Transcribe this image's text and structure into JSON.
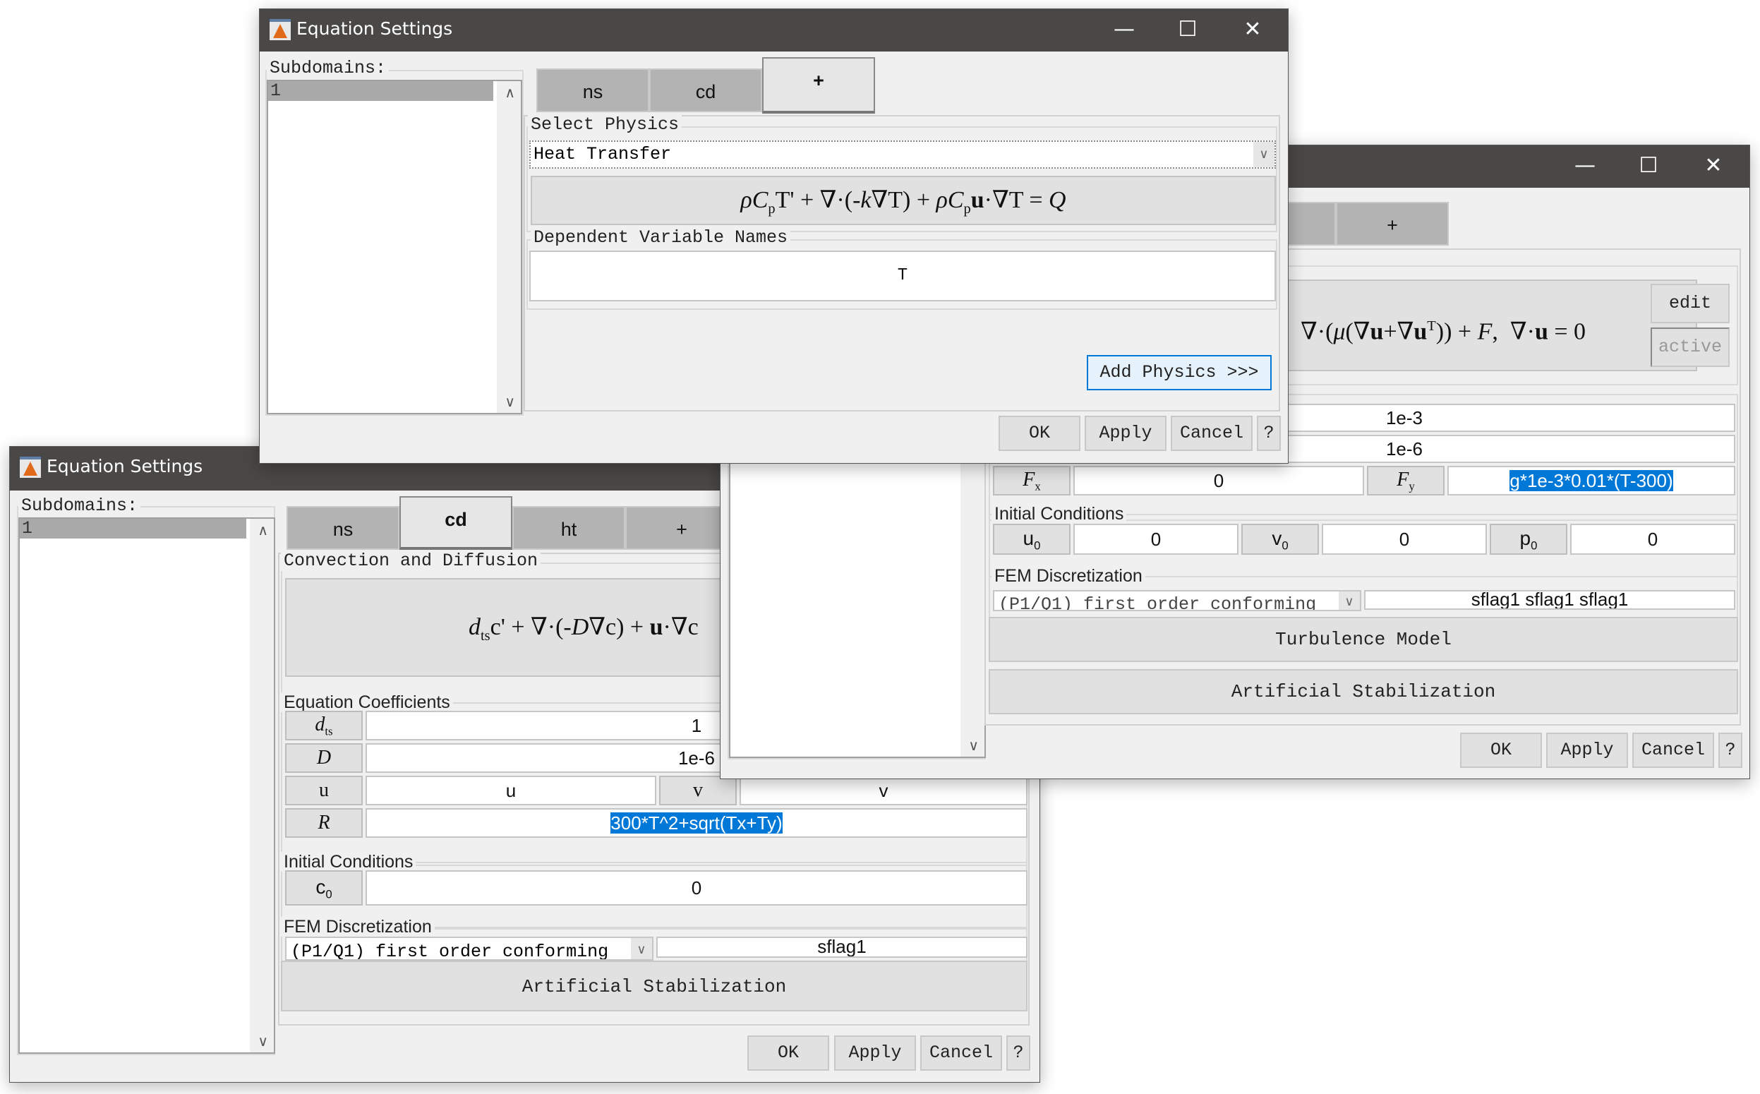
{
  "window_title": "Equation Settings",
  "window_controls": {
    "minimize": "—",
    "maximize": "☐",
    "close": "✕"
  },
  "icons": {
    "app": "matlab-icon",
    "scroll_up": "^",
    "scroll_down": "⌄",
    "dropdown": "v"
  },
  "dialog_ht_new": {
    "subdomains_label": "Subdomains:",
    "subdomains": [
      "1"
    ],
    "tabs": [
      {
        "label": "ns",
        "active": false
      },
      {
        "label": "cd",
        "active": false
      },
      {
        "label": "+",
        "active": true
      }
    ],
    "select_physics_label": "Select Physics",
    "select_physics_value": "Heat Transfer",
    "equation": "ρC_pT' + ∇·(-k∇T) + ρC_pu·∇T = Q",
    "dependent_vars_label": "Dependent Variable Names",
    "dependent_vars_value": "T",
    "add_physics_label": "Add Physics >>>",
    "buttons": {
      "ok": "OK",
      "apply": "Apply",
      "cancel": "Cancel",
      "help": "?"
    }
  },
  "dialog_ns": {
    "tabs": [
      {
        "label": "",
        "active": false
      },
      {
        "label": "+",
        "active": false
      }
    ],
    "equation_visible": "∇·(μ(∇u+∇uᵀ)) + F,  ∇·u = 0",
    "edit_label": "edit",
    "active_label": "active",
    "coefficients": {
      "rho": "1e-3",
      "mu": "1e-6",
      "Fx_label": "F_x",
      "Fx": "0",
      "Fy_label": "F_y",
      "Fy": "g*1e-3*0.01*(T-300)"
    },
    "initial_conditions_label": "Initial Conditions",
    "initial_conditions": [
      {
        "label": "u_0",
        "value": "0"
      },
      {
        "label": "v_0",
        "value": "0"
      },
      {
        "label": "p_0",
        "value": "0"
      }
    ],
    "fem_label": "FEM Discretization",
    "fem_option": "(P1/Q1) first order conforming",
    "fem_flags": "sflag1 sflag1 sflag1",
    "turbulence_label": "Turbulence Model",
    "stabilization_label": "Artificial Stabilization",
    "buttons": {
      "ok": "OK",
      "apply": "Apply",
      "cancel": "Cancel",
      "help": "?"
    }
  },
  "dialog_cd": {
    "subdomains_label": "Subdomains:",
    "subdomains": [
      "1"
    ],
    "tabs": [
      {
        "label": "ns",
        "active": false
      },
      {
        "label": "cd",
        "active": true
      },
      {
        "label": "ht",
        "active": false
      },
      {
        "label": "+",
        "active": false
      }
    ],
    "physics_label": "Convection and Diffusion",
    "equation_visible": "d_ts c' + ∇·(-D∇c) + u·∇c",
    "coefficients_label": "Equation Coefficients",
    "coefficients": {
      "dts_label": "d_ts",
      "dts": "1",
      "D_label": "D",
      "D": "1e-6",
      "u_label": "u",
      "u": "u",
      "v_label": "v",
      "v": "v",
      "R_label": "R",
      "R": "300*T^2+sqrt(Tx+Ty)"
    },
    "initial_conditions_label": "Initial Conditions",
    "c0_label": "c_0",
    "c0": "0",
    "fem_label": "FEM Discretization",
    "fem_option": "(P1/Q1) first order conforming",
    "fem_flags": "sflag1",
    "stabilization_label": "Artificial Stabilization",
    "buttons": {
      "ok": "OK",
      "apply": "Apply",
      "cancel": "Cancel",
      "help": "?"
    }
  },
  "colors": {
    "titlebar": "#4a4846",
    "selection": "#0078d7",
    "tab_inactive": "#b3b3b3",
    "tab_active": "#e6e6e6",
    "dialog_bg": "#f0f0f0"
  }
}
